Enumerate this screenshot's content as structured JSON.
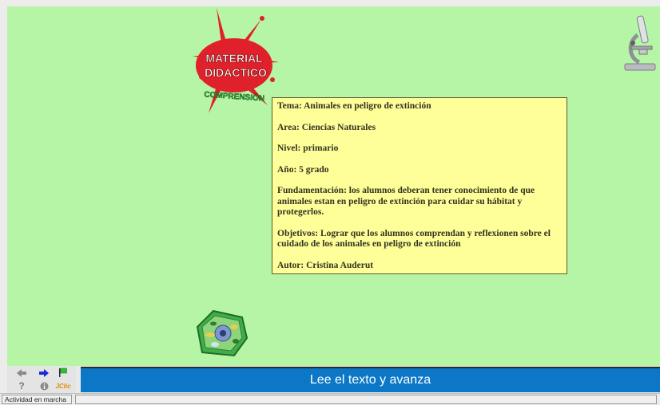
{
  "logo": {
    "line1": "MATERIAL",
    "line2": "DIDACTICO",
    "line3": "COMPRENSIÓN",
    "splash_color": "#e0202a"
  },
  "info": {
    "tema": "Tema: Animales en peligro de extinción",
    "area": "Area: Ciencias Naturales",
    "nivel": "Nivel: primario",
    "anio": "Año:  5 grado",
    "fundamentacion": "Fundamentación: los alumnos deberan tener conocimiento de que animales estan en peligro de extinción  para cuidar su hábitat y protegerlos.",
    "objetivos": "Objetivos: Lograr que los alumnos comprendan y reflexionen sobre el cuidado de los animales en peligro de extinción",
    "autor": "Autor: Cristina Auderut"
  },
  "controls": {
    "prev_icon": "arrow-left-icon",
    "next_icon": "arrow-right-icon",
    "flag_icon": "flag-icon",
    "help_label": "?",
    "info_icon": "info-icon",
    "jclic_label": "JClic"
  },
  "message": {
    "text": "Lee el texto y avanza",
    "color": "#0b77c6"
  },
  "status": {
    "text": "Actividad en marcha"
  },
  "colors": {
    "stage": "#b6f5a6",
    "panel": "#ffff99"
  }
}
